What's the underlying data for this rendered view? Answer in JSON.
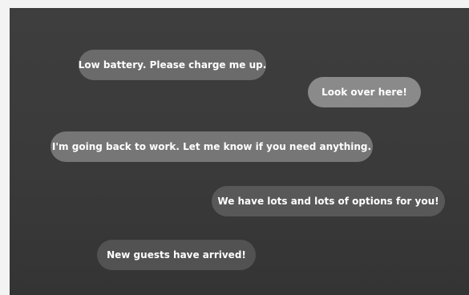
{
  "messages": [
    {
      "text": "Low battery. Please charge me up.",
      "color": "#6b6b6b"
    },
    {
      "text": "Look over here!",
      "color": "#8a8a8a"
    },
    {
      "text": "I'm going back to work. Let me know if you need anything.",
      "color": "#767676"
    },
    {
      "text": "We have lots and lots of options for you!",
      "color": "#585858"
    },
    {
      "text": "New guests have arrived!",
      "color": "#525252"
    }
  ],
  "background_color": "#3a3a3a"
}
